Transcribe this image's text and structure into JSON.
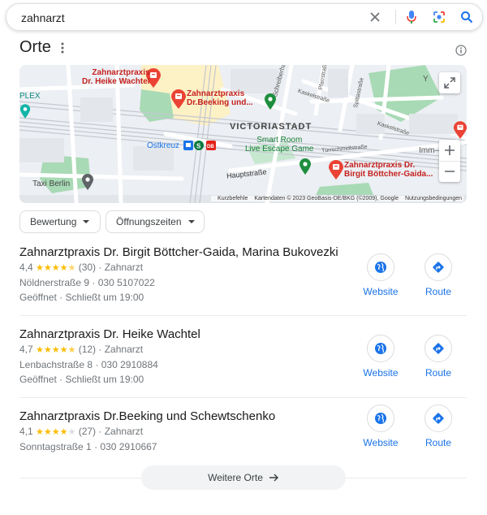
{
  "search": {
    "query": "zahnarzt"
  },
  "places": {
    "title": "Orte"
  },
  "map": {
    "labels": {
      "pin1": "Zahnarztpraxis\nDr. Heike Wachtel",
      "pin2": "Zahnarztpraxis\nDr.Beeking und...",
      "pin3": "Zahnarztpraxis Dr.\nBirgit Böttcher-Gaida...",
      "victoriastadt": "VICTORIASTADT",
      "smartroom": "Smart Room\nLive Escape Game",
      "ostkreuz": "Ostkreuz",
      "taxi": "Taxi Berlin",
      "plex": "PLEX",
      "immh": "Imm—H",
      "ylab": "Y",
      "streets": {
        "hauptstrasse": "Hauptstraße",
        "kaskelstrasse1": "Kaskelstraße",
        "kaskelstrasse2": "Kaskelstraße",
        "tuerrschmidt": "Türrschmidtstraße",
        "schreiberhauer": "Schreiberhauer Str.",
        "pfarrstrasse": "Pfarrstraße",
        "spittastrasse": "Spittastraße"
      }
    },
    "attribution": {
      "shortcuts": "Kurzbefehle",
      "mapdata": "Kartendaten © 2023 GeoBasis-DE/BKG (©2009), Google",
      "terms": "Nutzungsbedingungen"
    }
  },
  "filters": {
    "rating": "Bewertung",
    "hours": "Öffnungszeiten"
  },
  "results": [
    {
      "name": "Zahnarztpraxis Dr. Birgit Böttcher-Gaida, Marina Bukovezki",
      "rating": "4,4",
      "stars_full": "★★★★",
      "stars_rest": "★",
      "reviews": "(30)",
      "category": "Zahnarzt",
      "address": "Nöldnerstraße 9",
      "phone": "030 5107022",
      "status": "Geöffnet",
      "closes": "Schließt um 19:00"
    },
    {
      "name": "Zahnarztpraxis Dr. Heike Wachtel",
      "rating": "4,7",
      "stars_full": "★★★★",
      "stars_rest": "★",
      "reviews": "(12)",
      "category": "Zahnarzt",
      "address": "Lenbachstraße 8",
      "phone": "030 2910884",
      "status": "Geöffnet",
      "closes": "Schließt um 19:00"
    },
    {
      "name": "Zahnarztpraxis Dr.Beeking und Schewtschenko",
      "rating": "4,1",
      "stars_full": "★★★★",
      "stars_rest": "★",
      "reviews": "(27)",
      "category": "Zahnarzt",
      "address": "Sonntagstraße 1",
      "phone": "030 2910667"
    }
  ],
  "actions": {
    "website": "Website",
    "route": "Route"
  },
  "more": {
    "label": "Weitere Orte"
  },
  "colors": {
    "accent": "#1a73e8",
    "star": "#fbbc04",
    "pin": "#ea4335",
    "park": "#a8dab5"
  }
}
